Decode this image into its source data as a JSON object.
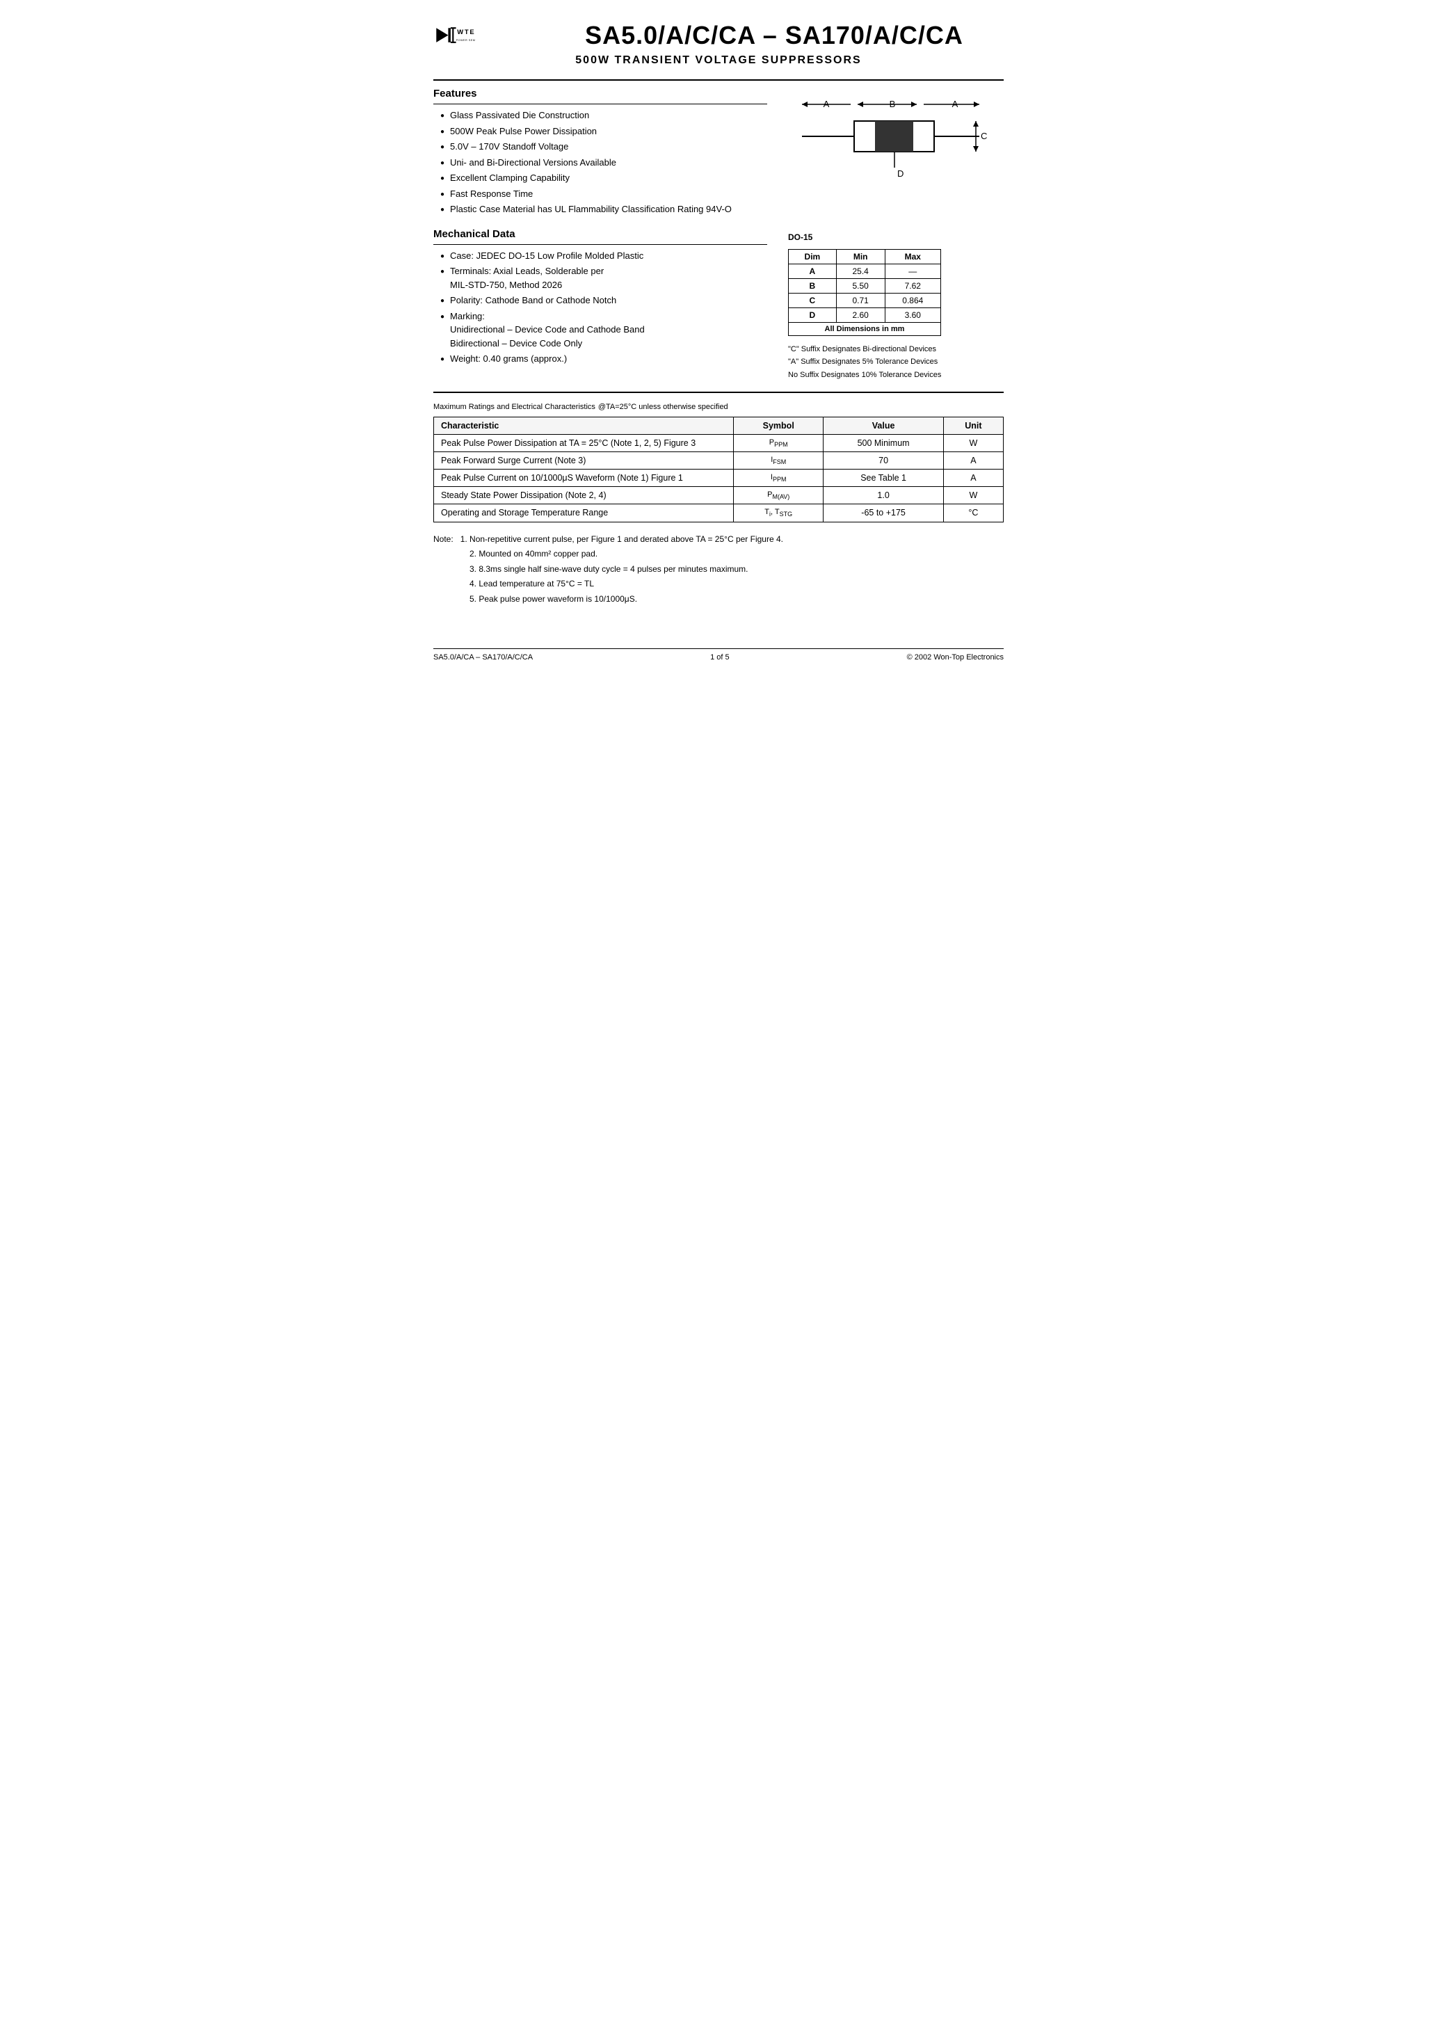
{
  "header": {
    "logo_wte": "WTE",
    "power_semi": "POWER SEMICONDUCTORS",
    "main_title": "SA5.0/A/C/CA – SA170/A/C/CA",
    "subtitle": "500W TRANSIENT VOLTAGE SUPPRESSORS"
  },
  "features_section": {
    "title": "Features",
    "items": [
      "Glass Passivated Die Construction",
      "500W Peak Pulse Power Dissipation",
      "5.0V – 170V Standoff Voltage",
      "Uni- and Bi-Directional Versions Available",
      "Excellent Clamping Capability",
      "Fast Response Time",
      "Plastic Case Material has UL Flammability Classification Rating 94V-O"
    ]
  },
  "mechanical_section": {
    "title": "Mechanical Data",
    "items": [
      "Case: JEDEC DO-15 Low Profile Molded Plastic",
      "Terminals: Axial Leads, Solderable per MIL-STD-750, Method 2026",
      "Polarity: Cathode Band or Cathode Notch",
      "Marking:",
      "Unidirectional – Device Code and Cathode Band",
      "Bidirectional – Device Code Only",
      "Weight: 0.40 grams (approx.)"
    ]
  },
  "do15_table": {
    "title": "DO-15",
    "headers": [
      "Dim",
      "Min",
      "Max"
    ],
    "rows": [
      {
        "dim": "A",
        "min": "25.4",
        "max": "—"
      },
      {
        "dim": "B",
        "min": "5.50",
        "max": "7.62"
      },
      {
        "dim": "C",
        "min": "0.71",
        "max": "0.864"
      },
      {
        "dim": "D",
        "min": "2.60",
        "max": "3.60"
      }
    ],
    "footer": "All Dimensions in mm"
  },
  "suffix_notes": [
    "\"C\" Suffix Designates Bi-directional Devices",
    "\"A\" Suffix Designates 5% Tolerance Devices",
    "No Suffix Designates 10% Tolerance Devices"
  ],
  "ratings_section": {
    "title": "Maximum Ratings and Electrical Characteristics",
    "subtitle": "@TA=25°C unless otherwise specified",
    "headers": [
      "Characteristic",
      "Symbol",
      "Value",
      "Unit"
    ],
    "rows": [
      {
        "characteristic": "Peak Pulse Power Dissipation at TA = 25°C (Note 1, 2, 5) Figure 3",
        "symbol": "PPPM",
        "value": "500 Minimum",
        "unit": "W"
      },
      {
        "characteristic": "Peak Forward Surge Current (Note 3)",
        "symbol": "IFSM",
        "value": "70",
        "unit": "A"
      },
      {
        "characteristic": "Peak Pulse Current on 10/1000μS Waveform (Note 1) Figure 1",
        "symbol": "IPPM",
        "value": "See Table 1",
        "unit": "A"
      },
      {
        "characteristic": "Steady State Power Dissipation (Note 2, 4)",
        "symbol": "PM(AV)",
        "value": "1.0",
        "unit": "W"
      },
      {
        "characteristic": "Operating and Storage Temperature Range",
        "symbol": "Ti, TSTG",
        "value": "-65 to +175",
        "unit": "°C"
      }
    ]
  },
  "notes": {
    "title": "Note:",
    "items": [
      "1.  Non-repetitive current pulse, per Figure 1 and derated above TA = 25°C per Figure 4.",
      "2.  Mounted on 40mm² copper pad.",
      "3.  8.3ms single half sine-wave duty cycle = 4 pulses per minutes maximum.",
      "4.  Lead temperature at 75°C = TL",
      "5.  Peak pulse power waveform is 10/1000μS."
    ]
  },
  "footer": {
    "left": "SA5.0/A/CA – SA170/A/C/CA",
    "center": "1 of 5",
    "right": "© 2002 Won-Top Electronics"
  }
}
